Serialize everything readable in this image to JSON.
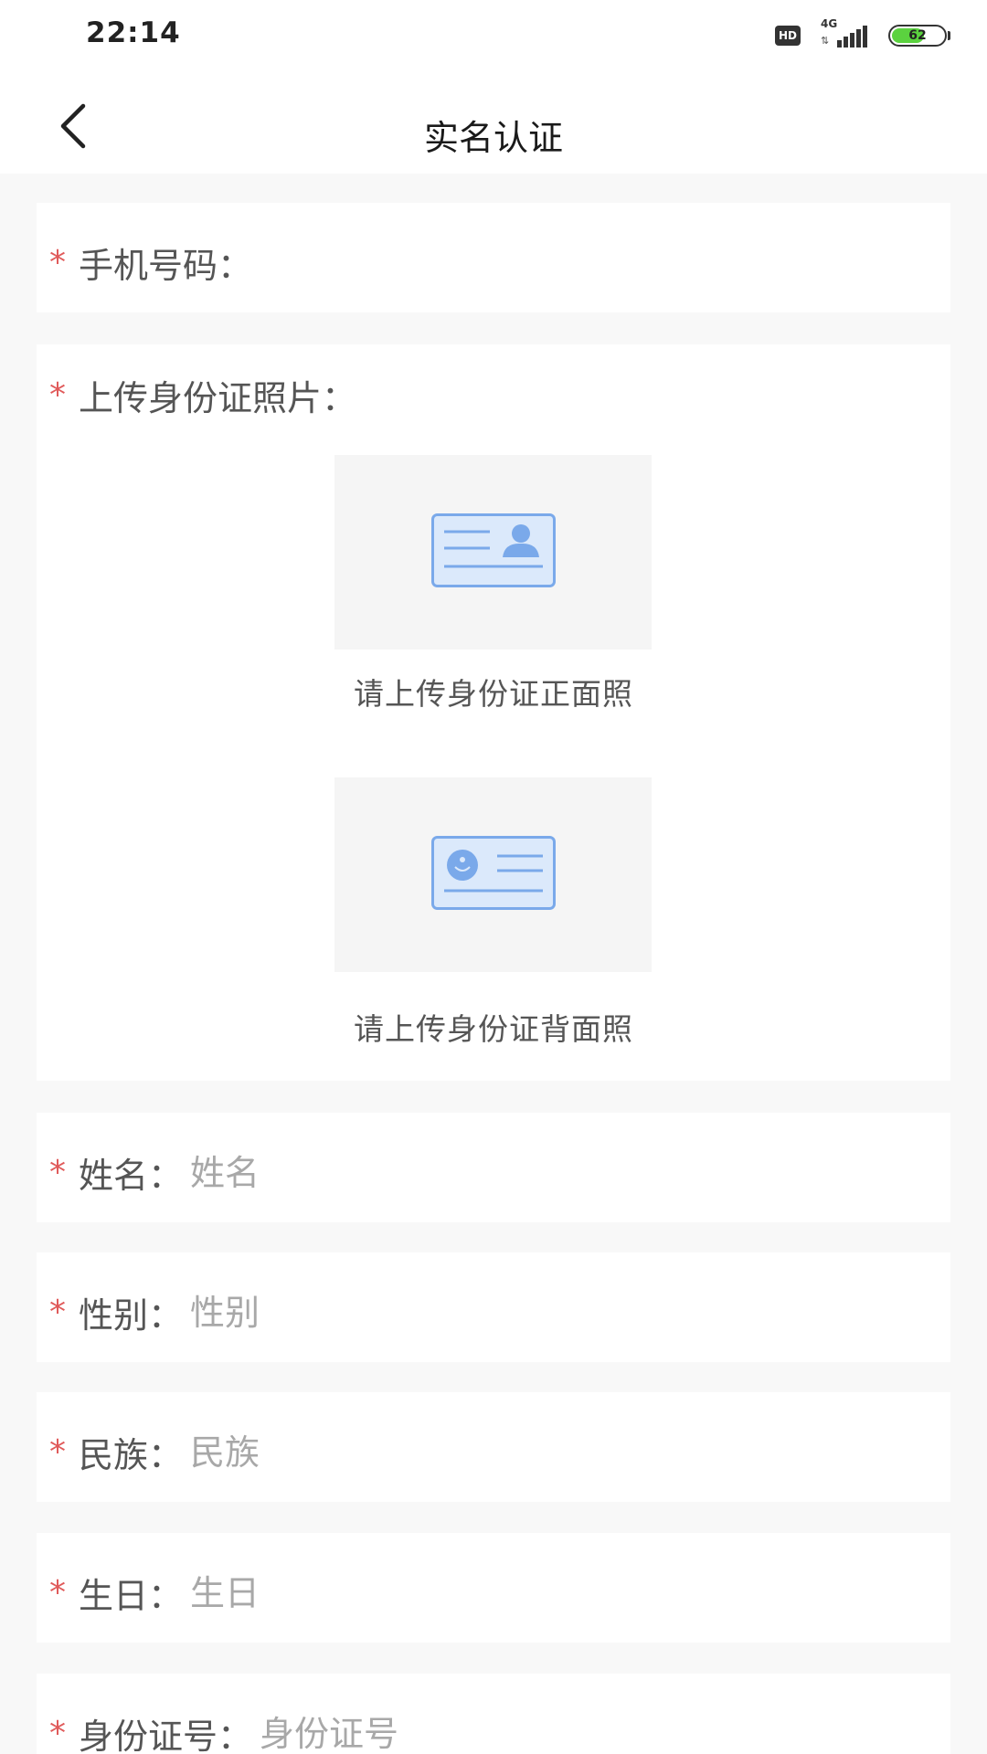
{
  "status_bar": {
    "time": "22:14",
    "hd_label": "HD",
    "network_label": "4G",
    "network_arrows": "⇅",
    "battery_level": "62"
  },
  "nav": {
    "title": "实名认证",
    "back_icon": "chevron-left-icon"
  },
  "colors": {
    "required_mark": "#e05a5a",
    "icon_blue": "#7aa9ea",
    "icon_fill": "#dbe9fb",
    "battery_fill": "#5bd23f"
  },
  "form": {
    "required_mark": "*",
    "phone": {
      "label": "手机号码：",
      "value": ""
    },
    "id_upload": {
      "label": "上传身份证照片：",
      "front_caption": "请上传身份证正面照",
      "back_caption": "请上传身份证背面照"
    },
    "name": {
      "label": "姓名：",
      "placeholder": "姓名"
    },
    "gender": {
      "label": "性别：",
      "placeholder": "性别"
    },
    "ethnicity": {
      "label": "民族：",
      "placeholder": "民族"
    },
    "birthday": {
      "label": "生日：",
      "placeholder": "生日"
    },
    "id_number": {
      "label": "身份证号：",
      "placeholder": "身份证号"
    }
  }
}
